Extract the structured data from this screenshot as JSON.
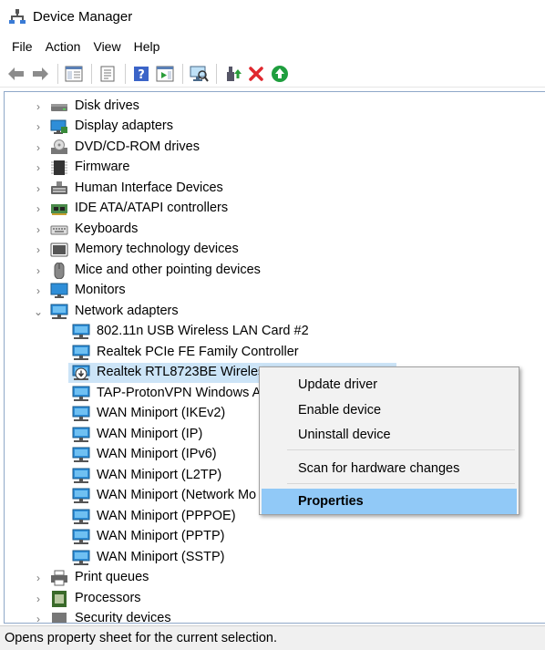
{
  "window": {
    "title": "Device Manager"
  },
  "menu": [
    "File",
    "Action",
    "View",
    "Help"
  ],
  "toolbar": {
    "buttons": [
      "back-icon",
      "forward-icon",
      "show-hide-console-tree-icon",
      "properties-icon",
      "help-icon",
      "action-pane-icon",
      "scan-hardware-icon",
      "update-driver-icon",
      "uninstall-icon",
      "enable-device-icon"
    ]
  },
  "tree": {
    "categories_top": [
      {
        "label": "Disk drives",
        "icon": "disk-drive-icon"
      },
      {
        "label": "Display adapters",
        "icon": "display-adapter-icon"
      },
      {
        "label": "DVD/CD-ROM drives",
        "icon": "dvd-drive-icon"
      },
      {
        "label": "Firmware",
        "icon": "firmware-icon"
      },
      {
        "label": "Human Interface Devices",
        "icon": "hid-icon"
      },
      {
        "label": "IDE ATA/ATAPI controllers",
        "icon": "ide-controller-icon"
      },
      {
        "label": "Keyboards",
        "icon": "keyboard-icon"
      },
      {
        "label": "Memory technology devices",
        "icon": "memory-device-icon"
      },
      {
        "label": "Mice and other pointing devices",
        "icon": "mouse-icon"
      },
      {
        "label": "Monitors",
        "icon": "monitor-icon"
      },
      {
        "label": "Network adapters",
        "icon": "network-adapter-icon",
        "expanded": true
      }
    ],
    "network_devices": [
      {
        "label": "802.11n USB Wireless LAN Card #2"
      },
      {
        "label": "Realtek PCIe FE Family Controller"
      },
      {
        "label": "Realtek RTL8723BE Wireless",
        "selected": true,
        "disabled": true
      },
      {
        "label": "TAP-ProtonVPN Windows Ad"
      },
      {
        "label": "WAN Miniport (IKEv2)"
      },
      {
        "label": "WAN Miniport (IP)"
      },
      {
        "label": "WAN Miniport (IPv6)"
      },
      {
        "label": "WAN Miniport (L2TP)"
      },
      {
        "label": "WAN Miniport (Network Mo"
      },
      {
        "label": "WAN Miniport (PPPOE)"
      },
      {
        "label": "WAN Miniport (PPTP)"
      },
      {
        "label": "WAN Miniport (SSTP)"
      }
    ],
    "categories_bottom": [
      {
        "label": "Print queues",
        "icon": "printer-icon"
      },
      {
        "label": "Processors",
        "icon": "processor-icon"
      },
      {
        "label": "Security devices",
        "icon": "security-device-icon"
      }
    ]
  },
  "context_menu": {
    "items": [
      {
        "label": "Update driver"
      },
      {
        "label": "Enable device"
      },
      {
        "label": "Uninstall device"
      },
      {
        "label": "Scan for hardware changes"
      },
      {
        "label": "Properties",
        "highlighted": true
      }
    ]
  },
  "status": {
    "text": "Opens property sheet for the current selection."
  },
  "colors": {
    "selection": "#cce4f7",
    "menu_highlight": "#91c9f7",
    "tree_border": "#8fa8c8"
  }
}
